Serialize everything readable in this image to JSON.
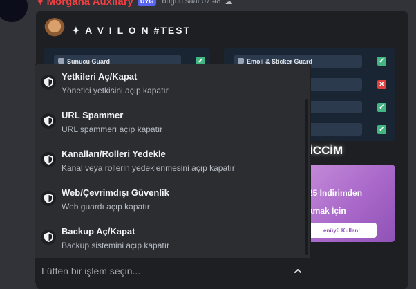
{
  "message": {
    "author": "Morgana Auxilary",
    "author_prefix": "✦",
    "app_badge": "UYG",
    "timestamp": "bugün saat 07:48",
    "icon_cloud": "cloud-icon"
  },
  "embed": {
    "title": "✦ A V I L O N #TEST",
    "left_fields": [
      {
        "label": "Sunucu Guard",
        "state": "on"
      }
    ],
    "right_fields": [
      {
        "label": "Emoji & Sticker Guard",
        "state": "on"
      },
      {
        "label": "",
        "state": "off"
      },
      {
        "label": "",
        "state": "on"
      },
      {
        "label": "",
        "state": "on"
      }
    ],
    "big_label": "İCCİM",
    "promo": {
      "line1": "25 İndirimden",
      "line2": "amak İçin",
      "button": "enüyü Kullan!"
    }
  },
  "dropdown": {
    "options": [
      {
        "label": "Yetkileri Aç/Kapat",
        "description": "Yönetici yetkisini açıp kapatır",
        "icon": "shield-icon"
      },
      {
        "label": "URL Spammer",
        "description": "URL spammerı açıp kapatır",
        "icon": "shield-icon"
      },
      {
        "label": "Kanalları/Rolleri Yedekle",
        "description": "Kanal veya rollerin yedeklenmesini açıp kapatır",
        "icon": "shield-icon"
      },
      {
        "label": "Web/Çevrimdışı Güvenlik",
        "description": "Web guardı açıp kapatır",
        "icon": "shield-icon"
      },
      {
        "label": "Backup Aç/Kapat",
        "description": "Backup sistemini açıp kapatır",
        "icon": "shield-icon"
      }
    ],
    "placeholder": "Lütfen bir işlem seçin...",
    "icon_chevron": "chevron-up-icon"
  },
  "colors": {
    "background": "#313338",
    "embed": "#1e1f22",
    "dropdown": "#2b2d31",
    "author": "#f23f42",
    "check_on": "#43b581",
    "check_off": "#e23f3f",
    "promo": "#a867c9"
  }
}
